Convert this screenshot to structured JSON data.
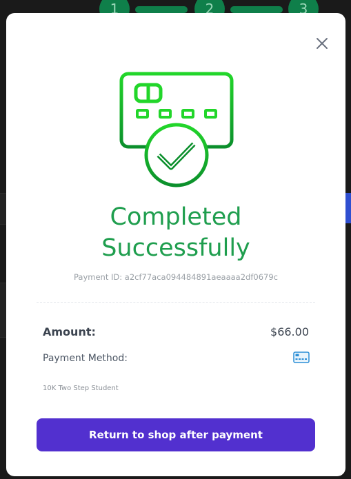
{
  "stepper": {
    "steps": [
      "1",
      "2",
      "3"
    ]
  },
  "modal": {
    "close_icon": "close-icon",
    "illustration_icon": "credit-card-check-icon",
    "title_line1": "Completed",
    "title_line2": "Successfully",
    "payment_id": "Payment ID: a2cf77aca094484891aeaaaa2df0679c",
    "amount_label": "Amount:",
    "amount_value": "$66.00",
    "payment_method_label": "Payment Method:",
    "payment_method_icon": "credit-card-icon",
    "product_name": "10K Two Step Student",
    "return_button_label": "Return to shop after payment"
  },
  "colors": {
    "success_green": "#1f9e4e",
    "button_purple": "#5230cf",
    "icon_green": "#22c82a"
  }
}
